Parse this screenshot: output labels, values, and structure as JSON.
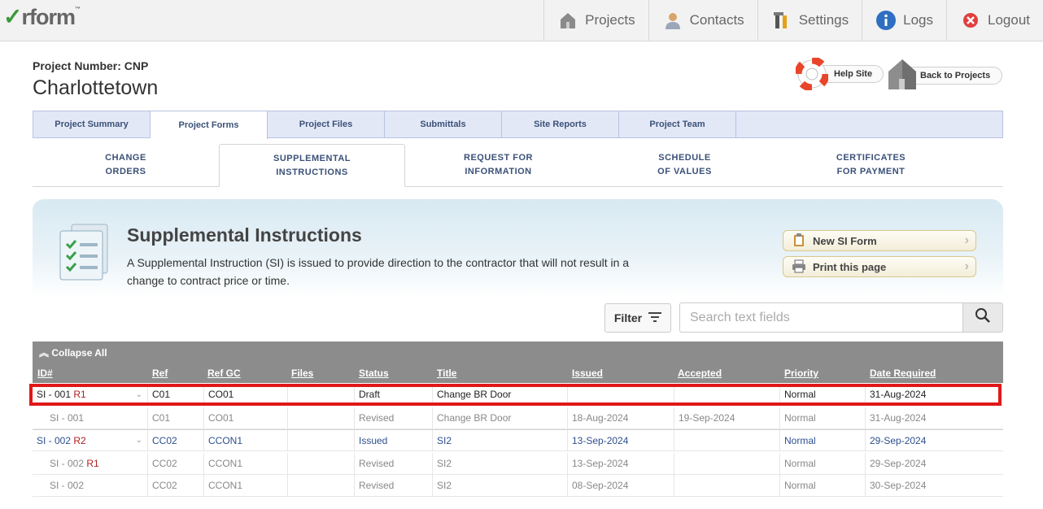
{
  "app": {
    "logo_text": "rform",
    "logo_tm": "™"
  },
  "nav": [
    {
      "label": "Projects",
      "icon": "house-icon"
    },
    {
      "label": "Contacts",
      "icon": "person-icon"
    },
    {
      "label": "Settings",
      "icon": "tools-icon"
    },
    {
      "label": "Logs",
      "icon": "info-icon"
    },
    {
      "label": "Logout",
      "icon": "close-circle-icon"
    }
  ],
  "header": {
    "project_number": "Project Number: CNP",
    "project_name": "Charlottetown",
    "help_label": "Help Site",
    "back_label": "Back to Projects"
  },
  "tabs": [
    "Project Summary",
    "Project Forms",
    "Project Files",
    "Submittals",
    "Site Reports",
    "Project Team"
  ],
  "subtabs": [
    {
      "line1": "CHANGE",
      "line2": "ORDERS"
    },
    {
      "line1": "SUPPLEMENTAL",
      "line2": "INSTRUCTIONS"
    },
    {
      "line1": "REQUEST FOR",
      "line2": "INFORMATION"
    },
    {
      "line1": "SCHEDULE",
      "line2": "OF VALUES"
    },
    {
      "line1": "CERTIFICATES",
      "line2": "FOR PAYMENT"
    }
  ],
  "banner": {
    "title": "Supplemental Instructions",
    "description": "A Supplemental Instruction (SI) is issued to provide direction to the contractor that will not result in a change to contract price or time.",
    "new_label": "New SI Form",
    "print_label": "Print this page"
  },
  "toolbar": {
    "filter_label": "Filter",
    "search_placeholder": "Search text fields"
  },
  "table": {
    "collapse_label": "Collapse All",
    "columns": [
      "ID#",
      "Ref",
      "Ref GC",
      "Files",
      "Status",
      "Title",
      "Issued",
      "Accepted",
      "Priority",
      "Date Required"
    ],
    "rows": [
      {
        "id": "SI - 001",
        "rev": "R1",
        "ref": "C01",
        "refgc": "CO01",
        "files": "",
        "status": "Draft",
        "title": "Change BR Door",
        "issued": "",
        "accepted": "",
        "priority": "Normal",
        "date_required": "31-Aug-2024"
      },
      {
        "id": "SI - 001",
        "rev": "",
        "ref": "C01",
        "refgc": "CO01",
        "files": "",
        "status": "Revised",
        "title": "Change BR Door",
        "issued": "18-Aug-2024",
        "accepted": "19-Sep-2024",
        "priority": "Normal",
        "date_required": "31-Aug-2024"
      },
      {
        "id": "SI - 002",
        "rev": "R2",
        "ref": "CC02",
        "refgc": "CCON1",
        "files": "",
        "status": "Issued",
        "title": "SI2",
        "issued": "13-Sep-2024",
        "accepted": "",
        "priority": "Normal",
        "date_required": "29-Sep-2024"
      },
      {
        "id": "SI - 002",
        "rev": "R1",
        "ref": "CC02",
        "refgc": "CCON1",
        "files": "",
        "status": "Revised",
        "title": "SI2",
        "issued": "13-Sep-2024",
        "accepted": "",
        "priority": "Normal",
        "date_required": "29-Sep-2024"
      },
      {
        "id": "SI - 002",
        "rev": "",
        "ref": "CC02",
        "refgc": "CCON1",
        "files": "",
        "status": "Revised",
        "title": "SI2",
        "issued": "08-Sep-2024",
        "accepted": "",
        "priority": "Normal",
        "date_required": "30-Sep-2024"
      }
    ]
  }
}
